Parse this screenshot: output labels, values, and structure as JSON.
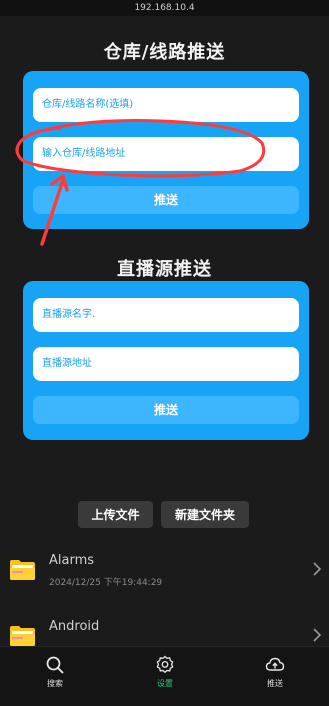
{
  "status_bar": {
    "ip": "192.168.10.4"
  },
  "colors": {
    "accent": "#18a4f6",
    "button": "#3db6ff",
    "active_tab": "#2ad07a",
    "annotation": "#ff3b3b"
  },
  "warehouse": {
    "title": "仓库/线路推送",
    "name_placeholder": "仓库/线路名称(选填)",
    "url_placeholder": "输入仓库/线路地址",
    "push_label": "推送"
  },
  "live": {
    "title": "直播源推送",
    "name_placeholder": "直播源名字.",
    "url_placeholder": "直播源地址",
    "push_label": "推送"
  },
  "actions": {
    "upload_label": "上传文件",
    "new_folder_label": "新建文件夹"
  },
  "files": [
    {
      "name": "Alarms",
      "date": "2024/12/25 下午19:44:29",
      "icon": "folder-icon"
    },
    {
      "name": "Android",
      "date": "",
      "icon": "folder-icon"
    }
  ],
  "nav": [
    {
      "label": "搜索",
      "icon": "search-icon",
      "active": false
    },
    {
      "label": "设置",
      "icon": "gear-icon",
      "active": true
    },
    {
      "label": "推送",
      "icon": "cloud-upload-icon",
      "active": false
    }
  ]
}
